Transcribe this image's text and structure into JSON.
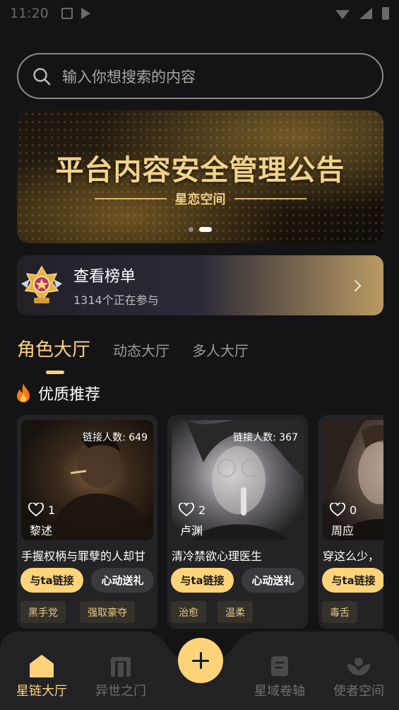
{
  "status_bar": {
    "time": "11:20"
  },
  "search": {
    "placeholder": "输入你想搜索的内容"
  },
  "banner": {
    "title": "平台内容安全管理公告",
    "subtitle": "星恋空间"
  },
  "leaderboard": {
    "title": "查看榜单",
    "participants": "1314个正在参与"
  },
  "tabs": [
    {
      "label": "角色大厅",
      "active": true
    },
    {
      "label": "动态大厅",
      "active": false
    },
    {
      "label": "多人大厅",
      "active": false
    }
  ],
  "section": {
    "title": "优质推荐"
  },
  "cards": [
    {
      "count_label": "链接人数: 649",
      "likes": "1",
      "name": "黎述",
      "desc": "手握权柄与罪孽的人却甘",
      "btn_link": "与ta链接",
      "btn_gift": "心动送礼",
      "tags": [
        "黑手党",
        "强取豪夺"
      ]
    },
    {
      "count_label": "链接人数: 367",
      "likes": "2",
      "name": "卢渊",
      "desc": "清冷禁欲心理医生",
      "btn_link": "与ta链接",
      "btn_gift": "心动送礼",
      "tags": [
        "治愈",
        "温柔"
      ]
    },
    {
      "count_label": "链",
      "likes": "0",
      "name": "周应",
      "desc": "穿这么少，",
      "btn_link": "与ta链接",
      "btn_gift": "",
      "tags": [
        "毒舌"
      ]
    }
  ],
  "bottom_nav": [
    {
      "label": "星链大厅",
      "icon": "home-icon",
      "active": true
    },
    {
      "label": "异世之门",
      "icon": "gate-icon",
      "active": false
    },
    {
      "label": "星域卷轴",
      "icon": "scroll-icon",
      "active": false
    },
    {
      "label": "使者空间",
      "icon": "lotus-icon",
      "active": false
    }
  ],
  "colors": {
    "accent": "#ffd37a",
    "background": "#141416",
    "card": "#232326"
  }
}
